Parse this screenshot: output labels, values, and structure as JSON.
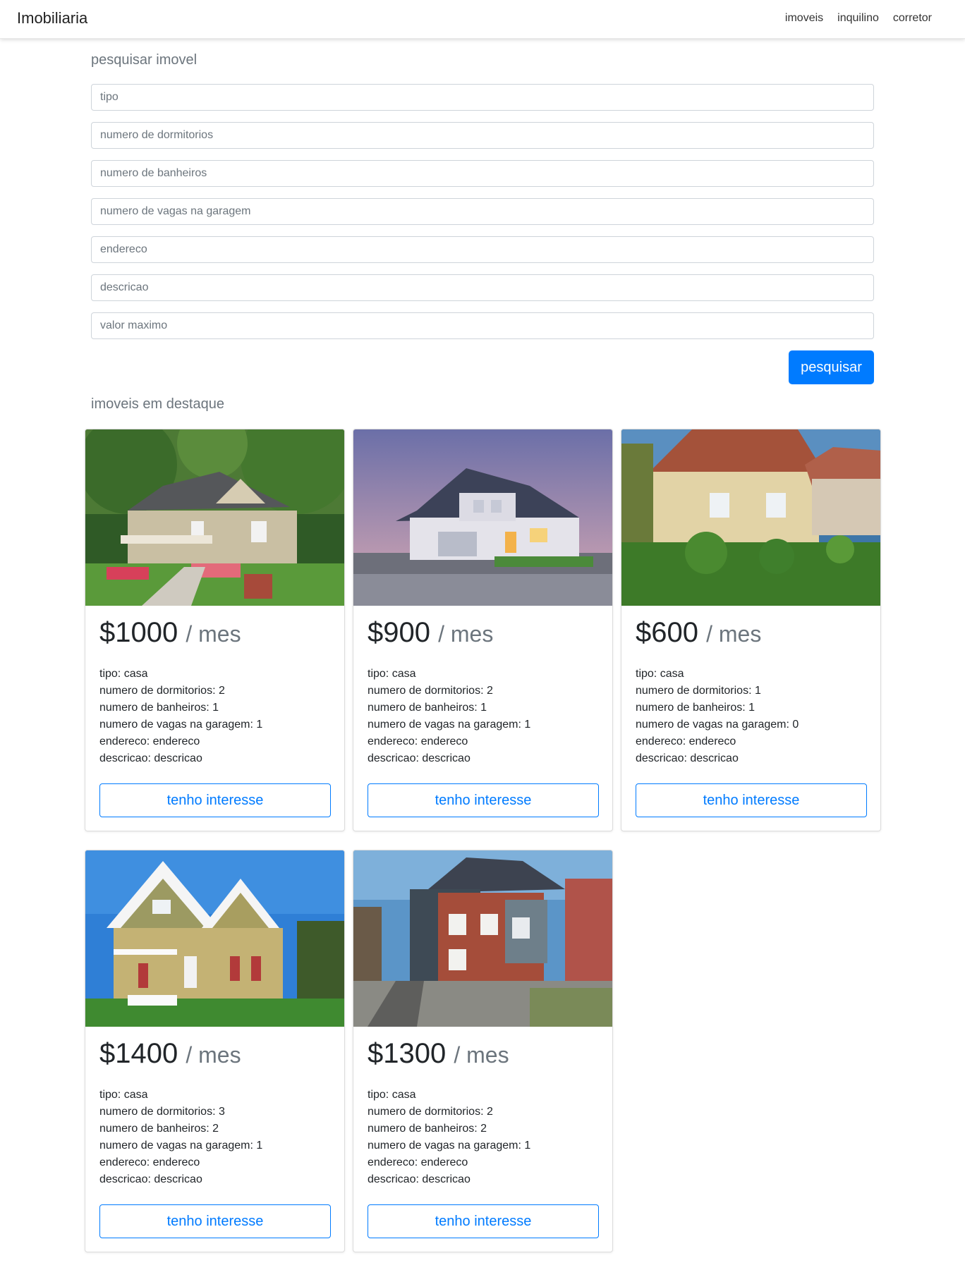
{
  "navbar": {
    "brand": "Imobiliaria",
    "links": [
      "imoveis",
      "inquilino",
      "corretor"
    ]
  },
  "search": {
    "title": "pesquisar imovel",
    "fields": [
      {
        "placeholder": "tipo",
        "value": ""
      },
      {
        "placeholder": "numero de dormitorios",
        "value": ""
      },
      {
        "placeholder": "numero de banheiros",
        "value": ""
      },
      {
        "placeholder": "numero de vagas na garagem",
        "value": ""
      },
      {
        "placeholder": "endereco",
        "value": ""
      },
      {
        "placeholder": "descricao",
        "value": ""
      },
      {
        "placeholder": "valor maximo",
        "value": ""
      }
    ],
    "button_label": "pesquisar"
  },
  "featured": {
    "title": "imoveis em destaque",
    "listings": [
      {
        "price": "$1000",
        "per": "/ mes",
        "specs": [
          "tipo: casa",
          "numero de dormitorios: 2",
          "numero de banheiros: 1",
          "numero de vagas na garagem: 1",
          "endereco: endereco",
          "descricao: descricao"
        ],
        "button_label": "tenho interesse"
      },
      {
        "price": "$900",
        "per": "/ mes",
        "specs": [
          "tipo: casa",
          "numero de dormitorios: 2",
          "numero de banheiros: 1",
          "numero de vagas na garagem: 1",
          "endereco: endereco",
          "descricao: descricao"
        ],
        "button_label": "tenho interesse"
      },
      {
        "price": "$600",
        "per": "/ mes",
        "specs": [
          "tipo: casa",
          "numero de dormitorios: 1",
          "numero de banheiros: 1",
          "numero de vagas na garagem: 0",
          "endereco: endereco",
          "descricao: descricao"
        ],
        "button_label": "tenho interesse"
      },
      {
        "price": "$1400",
        "per": "/ mes",
        "specs": [
          "tipo: casa",
          "numero de dormitorios: 3",
          "numero de banheiros: 2",
          "numero de vagas na garagem: 1",
          "endereco: endereco",
          "descricao: descricao"
        ],
        "button_label": "tenho interesse"
      },
      {
        "price": "$1300",
        "per": "/ mes",
        "specs": [
          "tipo: casa",
          "numero de dormitorios: 2",
          "numero de banheiros: 2",
          "numero de vagas na garagem: 1",
          "endereco: endereco",
          "descricao: descricao"
        ],
        "button_label": "tenho interesse"
      }
    ]
  },
  "colors": {
    "primary": "#007bff",
    "muted": "#6c757d"
  }
}
